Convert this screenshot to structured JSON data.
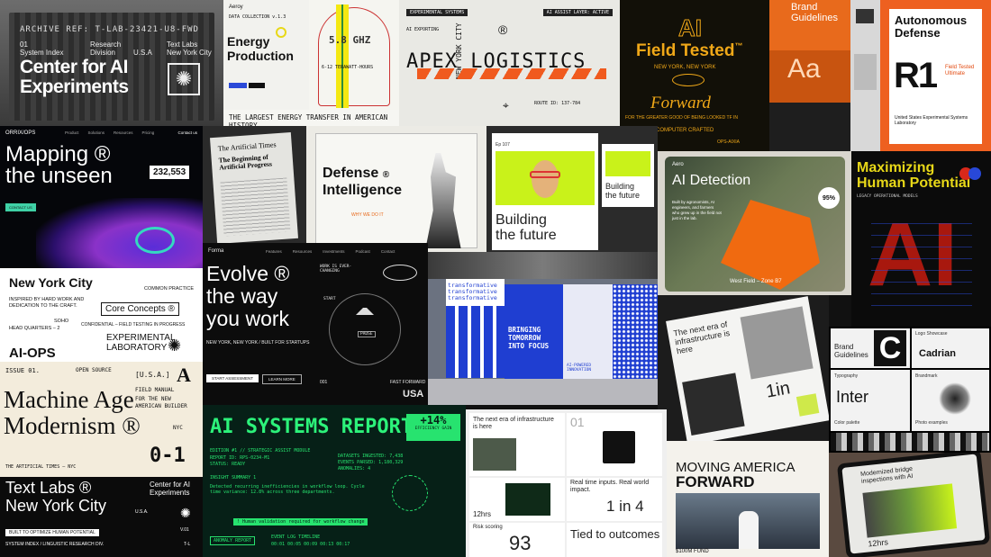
{
  "archive": {
    "ref": "ARCHIVE REF: T-LAB-23421-U8-FWD",
    "num": "01",
    "index": "System Index",
    "research": "Research",
    "division": "Division",
    "usa": "U.S.A",
    "textlabs": "Text Labs",
    "nyc": "New York City",
    "title_1": "Center for AI",
    "title_2": "Experiments"
  },
  "energy": {
    "brand": "Aeroy",
    "collection": "DATA COLLECTION v.1.3",
    "title_1": "Energy",
    "title_2": "Production",
    "caption": "THE LARGEST ENERGY TRANSFER IN AMERICAN HISTORY"
  },
  "frequency": {
    "big": "5.8 GHZ",
    "small": "6-12 TERAWATT-HOURS"
  },
  "apex": {
    "header": "EXPERIMENTAL SYSTEMS",
    "tag": "AI ASSIST LAYER: ACTIVE",
    "sub": "AI EXPORTING",
    "vertical": "NEW YORK CITY",
    "reg": "®",
    "title": "APEX LOGISTICS",
    "meta": "ROUTE ID: 137-784"
  },
  "field": {
    "big": "AI",
    "title": "Field Tested",
    "tm": "™",
    "city": "NEW YORK, NEW YORK",
    "script": "Forward",
    "note": "FOR THE GREATER GOOD OF BEING LOOKED TF IN",
    "footer": "COMPUTER CRAFTED",
    "code": "OPS-AIXIA"
  },
  "brand_guidelines": {
    "title_1": "Brand",
    "title_2": "Guidelines",
    "sample": "Aa"
  },
  "defense_r1": {
    "title_1": "Autonomous",
    "title_2": "Defense",
    "code": "R1",
    "side_1": "Field Tested",
    "side_2": "Ultimate",
    "footer": "United States Experimental Systems Laboratory"
  },
  "mapping": {
    "brand": "ORRIX/OPS",
    "nav": [
      "Product",
      "Solutions",
      "Resources",
      "Pricing"
    ],
    "contact": "Contact us",
    "title_1": "Mapping ®",
    "title_2": "the unseen",
    "count": "232,553",
    "cta": "CONTACT US"
  },
  "times": {
    "masthead": "The Artificial Times",
    "headline": "The Beginning of Artificial Progress"
  },
  "defense_intel": {
    "title_1": "Defense",
    "reg": "®",
    "title_2": "Intelligence",
    "note": "WHY WE DO IT"
  },
  "building": {
    "title_1": "Building",
    "title_2": "the future",
    "ep": "Ep 107"
  },
  "detection": {
    "brand": "Aero",
    "title": "AI Detection",
    "body": "Built by agronomists, AI engineers, and farmers who grew up in the field not just in the lab.",
    "pct": "95%",
    "zone": "West Field – Zone B7"
  },
  "maximizing": {
    "title_1": "Maximizing",
    "title_2": "Human Potential",
    "code": "LEGACY OPERATIONAL MODELS",
    "big": "AI"
  },
  "nyc_poster": {
    "title": "New York City",
    "practice": "COMMON PRACTICE",
    "body": "INSPIRED BY HARD WORK AND DEDICATION TO THE CRAFT.",
    "core": "Core Concepts ®",
    "soho": "SOHO",
    "hq": "HEAD QUARTERS – 2",
    "confidential": "CONFIDENTIAL – FIELD TESTING IN PROGRESS",
    "lab_1": "EXPERIMENTAL",
    "lab_2": "LABORATORY",
    "ops": "AI-OPS"
  },
  "evolve": {
    "brand": "Forma",
    "nav": [
      "Features",
      "Resources",
      "Investments",
      "Podcast",
      "Contact"
    ],
    "title_1": "Evolve ®",
    "title_2": "the way",
    "title_3": "you work",
    "side": "WORK IS EVER-CHANGING",
    "start": "START",
    "pause": "PAUSE",
    "city": "NEW YORK, NEW YORK  /  BUILT FOR STARTUPS",
    "cta_1": "START ASSESSMENT",
    "cta_2": "LEARN MORE",
    "footer_1": "001",
    "footer_2": "FAST FORWARD",
    "usa": "USA"
  },
  "bringing": {
    "title": "BRINGING TOMORROW INTO FOCUS",
    "repeat": "transformative",
    "sub": "AI-POWERED INNOVATION"
  },
  "magazine": {
    "headline": "The next era of infrastructure is here",
    "stat": "1in"
  },
  "cadrian": {
    "brand_1": "Brand",
    "brand_2": "Guidelines",
    "logo": "Logo Showcase",
    "name": "Cadrian",
    "typography": "Typography",
    "font": "Inter",
    "color": "Color palette",
    "photo": "Photo examples",
    "brandmark": "Brandmark"
  },
  "machine": {
    "issue": "ISSUE 01.",
    "open": "OPEN SOURCE",
    "tag": "[U.S.A.]",
    "glyph": "A",
    "manual": "FIELD MANUAL",
    "for_1": "FOR THE NEW",
    "for_2": "AMERICAN BUILDER",
    "title_1": "Machine Age",
    "title_2": "Modernism ®",
    "nyc": "NYC",
    "num": "0-1",
    "footer": "THE ARTIFICIAL TIMES – NYC"
  },
  "systems": {
    "title": "AI SYSTEMS REPORT",
    "badge": "+14%",
    "badge_sub": "EFFICIENCY GAIN",
    "header": "EDITION #1 // STRATEGIC ASSIST MODULE",
    "lines": [
      "REPORT ID: RPS-0234-M1",
      "STATUS: READY"
    ],
    "stats": [
      "DATASETS INGESTED: 7,438",
      "EVENTS PARSED: 1,180,329",
      "ANOMALIES: 4"
    ],
    "anomaly": "! Human validation required for workflow change",
    "insight": "INSIGHT SUMMARY 1",
    "body": "Detected recurring inefficiencies in workflow loop. Cycle time variance: 12.8% across three departments.",
    "report": "ANOMALY REPORT",
    "log": "EVENT LOG TIMELINE",
    "times": "00:01 00:05 00:09 00:13 00:17"
  },
  "next_era": {
    "headline": "The next era of infrastructure is here",
    "num": "01",
    "real": "Real time inputs. Real world impact.",
    "stat": "12hrs",
    "ratio": "1 in 4",
    "risk": "Risk scoring",
    "big": "93",
    "tied": "Tied to outcomes"
  },
  "moving": {
    "title_1": "MOVING AMERICA",
    "title_2": "FORWARD",
    "fund": "$100M FUND"
  },
  "tablet": {
    "headline": "Modernized bridge inspections with AI",
    "stat": "12hrs"
  },
  "textlabs": {
    "title_1": "Text Labs ®",
    "title_2": "New York City",
    "center_1": "Center for AI",
    "center_2": "Experiments",
    "usa": "U.S.A.",
    "optimize": "BUILT TO OPTIMIZE HUMAN POTENTIAL",
    "index": "SYSTEM INDEX / LINGUISTIC RESEARCH DIV.",
    "version": "V.01",
    "tl": "T-L"
  }
}
